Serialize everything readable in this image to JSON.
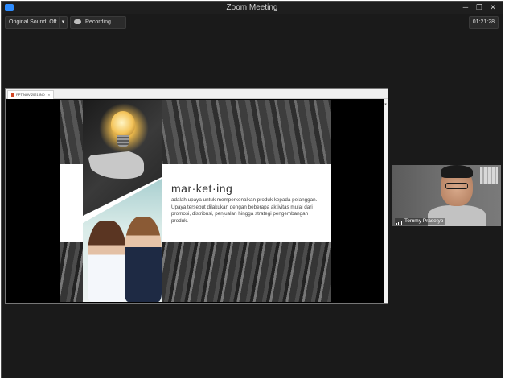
{
  "window": {
    "title": "Zoom Meeting"
  },
  "toolbar": {
    "original_sound_label": "Original Sound: Off",
    "dropdown_caret": "▾",
    "recording_label": "Recording...",
    "timer": "01:21:28"
  },
  "share": {
    "tab_label": "PPT NOV 2021 IND",
    "tab_close": "×",
    "slide": {
      "heading": "mar·ket·ing",
      "body": "adalah upaya untuk memperkenalkan produk kepada pelanggan. Upaya tersebut dilakukan dengan beberapa aktivitas mulai dari promosi, distribusi, penjualan hingga strategi pengembangan produk."
    }
  },
  "participant": {
    "name": "Tommy Prasetyo"
  }
}
